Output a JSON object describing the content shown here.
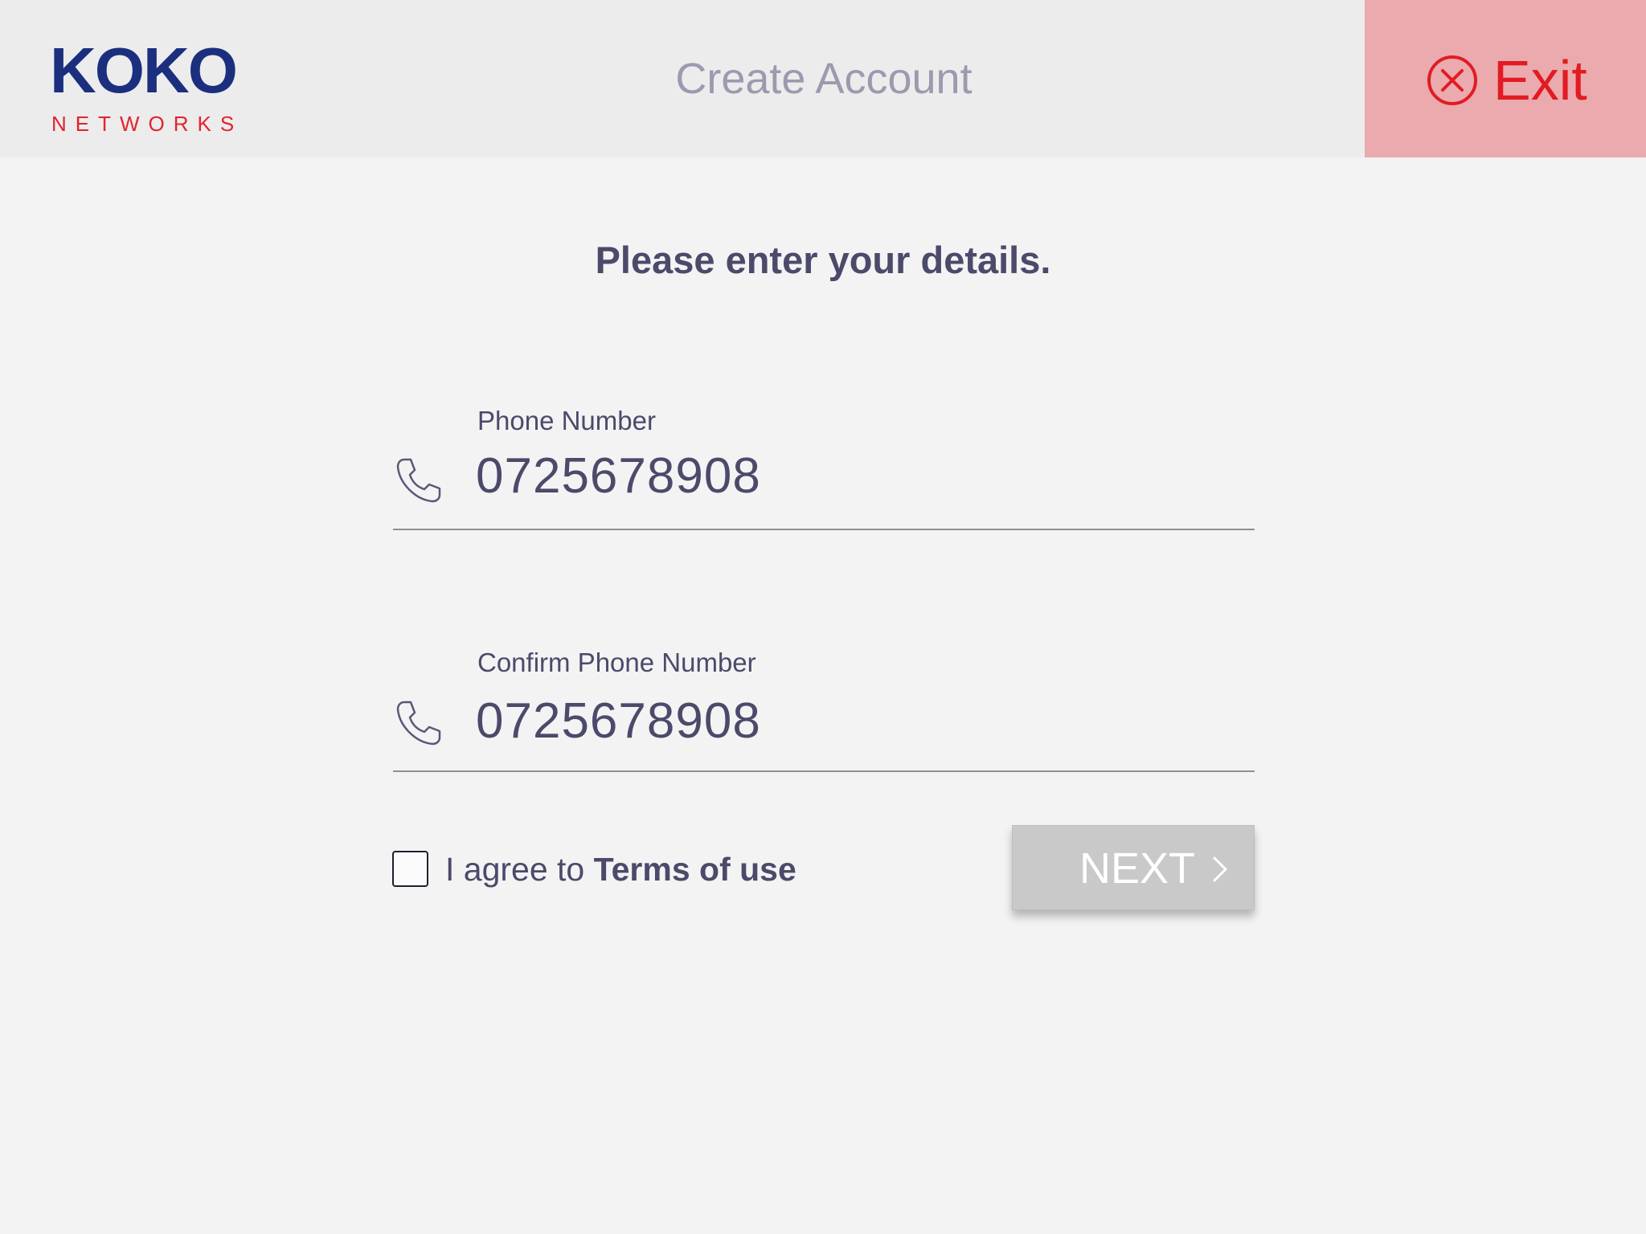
{
  "header": {
    "logo": {
      "word": "KOKO",
      "sub": "NETWORKS"
    },
    "title": "Create Account",
    "exit_label": "Exit"
  },
  "form": {
    "intro": "Please enter your details.",
    "phone": {
      "label": "Phone Number",
      "value": "0725678908",
      "icon": "phone-icon"
    },
    "confirm_phone": {
      "label": "Confirm Phone Number",
      "value": "0725678908",
      "icon": "phone-icon"
    },
    "agree": {
      "prefix": "I agree to ",
      "link": "Terms of use",
      "checked": false
    },
    "next_label": "NEXT"
  },
  "colors": {
    "brand_blue": "#1b2f7e",
    "brand_red": "#e3232d",
    "exit_bg": "#eaaaae",
    "text": "#4b4a6b",
    "next_bg": "#c9c9c9"
  }
}
